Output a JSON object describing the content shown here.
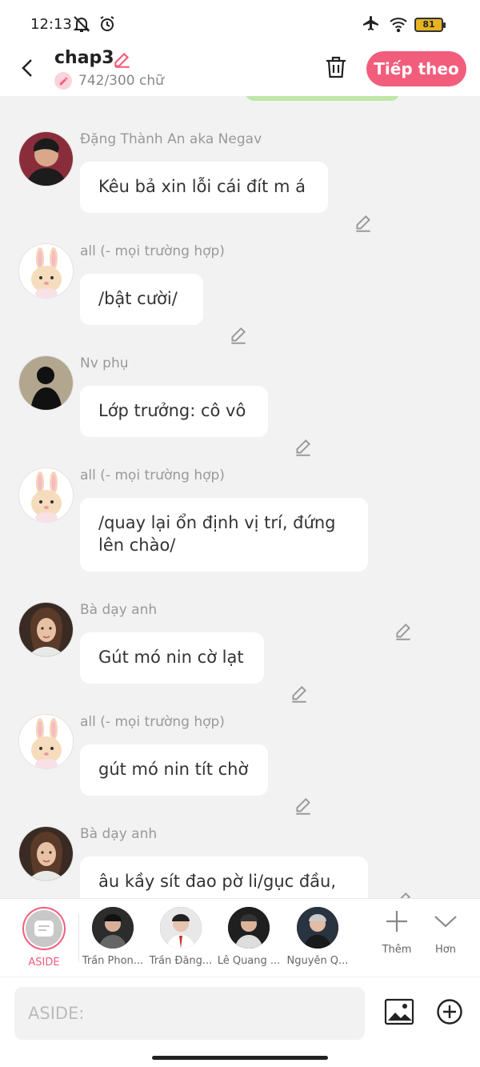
{
  "status_bar": {
    "time": "12:13",
    "battery": "81"
  },
  "header": {
    "title": "chap3",
    "word_count": "742/300 chữ",
    "next_label": "Tiếp theo"
  },
  "messages": [
    {
      "sender": "Đặng Thành An aka Negav",
      "text": "Kêu bả xin lỗi cái đít m á",
      "avatar": "man-dark-avatar"
    },
    {
      "sender": "all (- mọi trường hợp)",
      "text": "/bật cười/",
      "avatar": "bunny-avatar"
    },
    {
      "sender": "Nv phụ",
      "text": "Lớp trưởng: cô vô",
      "avatar": "silhouette-avatar"
    },
    {
      "sender": "all (- mọi trường hợp)",
      "text": "/quay lại ổn định vị trí, đứng lên chào/",
      "avatar": "bunny-avatar"
    },
    {
      "sender": "Bà dạy anh",
      "text": "Gút mó nin cờ lạt",
      "avatar": "woman-avatar"
    },
    {
      "sender": "all (- mọi trường hợp)",
      "text": "gút mó nin tít chờ",
      "avatar": "bunny-avatar"
    },
    {
      "sender": "Bà dạy anh",
      "text": "âu kầy sít đao pờ li/gục đầu,",
      "avatar": "woman-avatar"
    }
  ],
  "character_bar": {
    "aside": "ASIDE",
    "characters": [
      "Trần Phon...",
      "Trần Đăng...",
      "Lê Quang ...",
      "Nguyễn Q..."
    ],
    "more_label": "Thêm",
    "expand_label": "Hơn"
  },
  "input": {
    "placeholder": "ASIDE:"
  },
  "colors": {
    "accent": "#f25d7b",
    "background": "#f2f2f2"
  }
}
